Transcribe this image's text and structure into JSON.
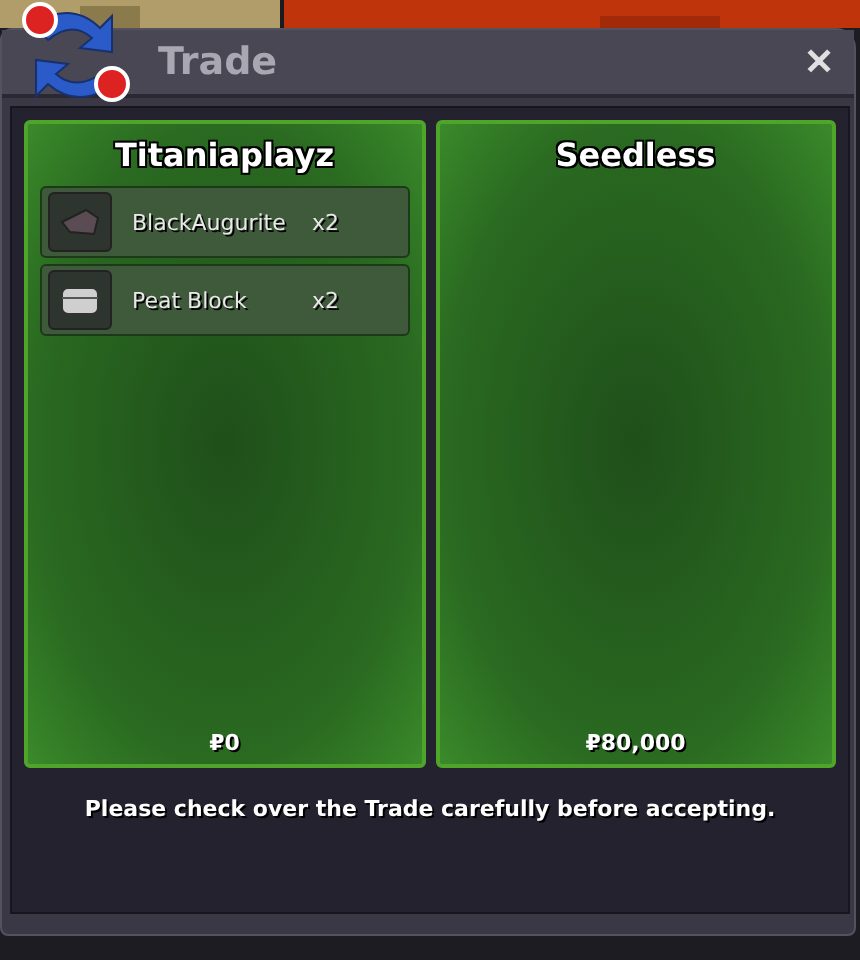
{
  "window": {
    "title": "Trade",
    "close": "✕"
  },
  "offers": [
    {
      "player": "Titaniaplayz",
      "items": [
        {
          "name": "BlackAugurite",
          "qty": "x2",
          "kind": "stone"
        },
        {
          "name": "Peat Block",
          "qty": "x2",
          "kind": "chest"
        }
      ],
      "money": "₽0"
    },
    {
      "player": "Seedless",
      "money": "₽80,000"
    }
  ],
  "notice": "Please check over the Trade carefully before accepting."
}
